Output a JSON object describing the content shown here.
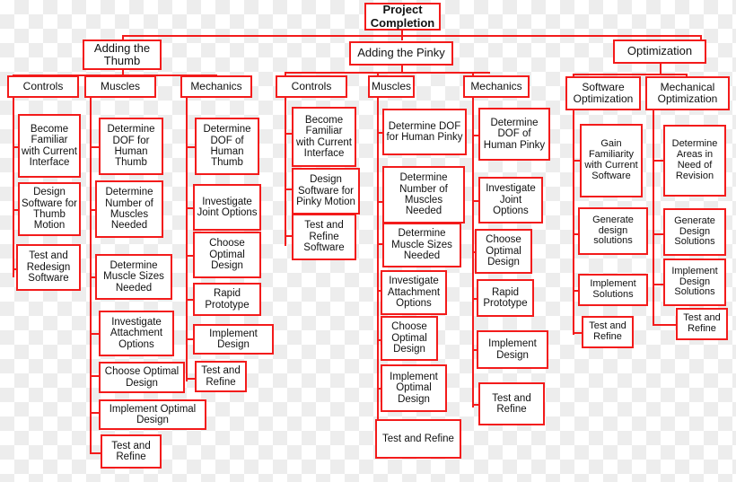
{
  "diagram": {
    "title": "Project Completion Work Breakdown Structure",
    "accent_color": "#f31b1b",
    "box_fill": "#ffffff",
    "text_color": "#111111"
  },
  "root": {
    "label": "Project Completion"
  },
  "branches": [
    {
      "label": "Adding the Thumb",
      "categories": [
        {
          "label": "Controls",
          "tasks": [
            "Become Familiar with Current Interface",
            "Design Software for Thumb Motion",
            "Test and Redesign Software"
          ]
        },
        {
          "label": "Muscles",
          "tasks": [
            "Determine DOF for Human Thumb",
            "Determine Number of Muscles Needed",
            "Determine Muscle Sizes Needed",
            "Investigate Attachment Options",
            "Choose Optimal Design",
            "Implement Optimal Design",
            "Test and Refine"
          ]
        },
        {
          "label": "Mechanics",
          "tasks": [
            "Determine DOF of Human Thumb",
            "Investigate Joint Options",
            "Choose Optimal Design",
            "Rapid Prototype",
            "Implement Design",
            "Test and Refine"
          ]
        }
      ]
    },
    {
      "label": "Adding the Pinky",
      "categories": [
        {
          "label": "Controls",
          "tasks": [
            "Become Familiar with Current Interface",
            "Design Software for Pinky Motion",
            "Test and Refine Software"
          ]
        },
        {
          "label": "Muscles",
          "tasks": [
            "Determine DOF for Human Pinky",
            "Determine Number of Muscles Needed",
            "Determine Muscle Sizes Needed",
            "Investigate Attachment Options",
            "Choose Optimal Design",
            "Implement Optimal Design",
            "Test and Refine"
          ]
        },
        {
          "label": "Mechanics",
          "tasks": [
            "Determine DOF of Human Pinky",
            "Investigate Joint Options",
            "Choose Optimal Design",
            "Rapid Prototype",
            "Implement Design",
            "Test and Refine"
          ]
        }
      ]
    },
    {
      "label": "Optimization",
      "categories": [
        {
          "label": "Software Optimization",
          "tasks": [
            "Gain Familiarity with Current Software",
            "Generate design solutions",
            "Implement Solutions",
            "Test and Refine"
          ]
        },
        {
          "label": "Mechanical Optimization",
          "tasks": [
            "Determine Areas in Need of Revision",
            "Generate Design Solutions",
            "Implement Design Solutions",
            "Test and Refine"
          ]
        }
      ]
    }
  ]
}
